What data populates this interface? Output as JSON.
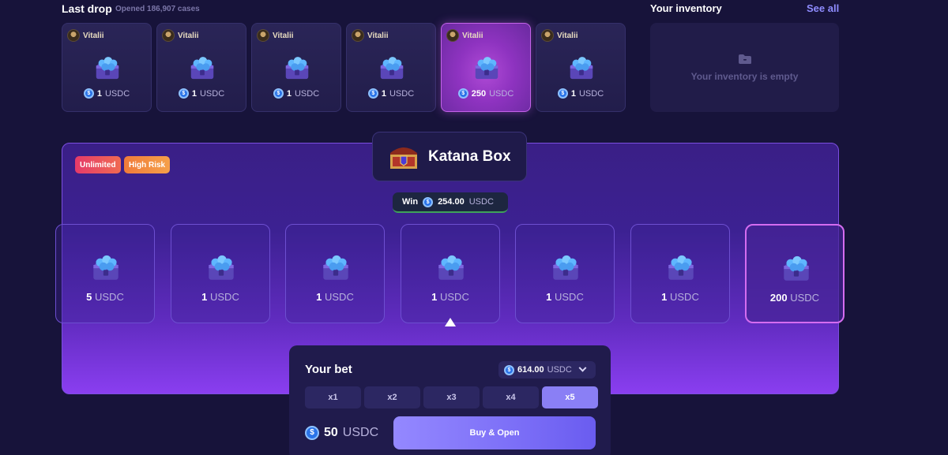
{
  "last_drop": {
    "title": "Last drop",
    "subtitle": "Opened 186,907 cases",
    "items": [
      {
        "user": "Vitalii",
        "amount": "1",
        "unit": "USDC",
        "highlight": false
      },
      {
        "user": "Vitalii",
        "amount": "1",
        "unit": "USDC",
        "highlight": false
      },
      {
        "user": "Vitalii",
        "amount": "1",
        "unit": "USDC",
        "highlight": false
      },
      {
        "user": "Vitalii",
        "amount": "1",
        "unit": "USDC",
        "highlight": false
      },
      {
        "user": "Vitalii",
        "amount": "250",
        "unit": "USDC",
        "highlight": true
      },
      {
        "user": "Vitalii",
        "amount": "1",
        "unit": "USDC",
        "highlight": false
      }
    ]
  },
  "inventory": {
    "title": "Your inventory",
    "see_all": "See all",
    "empty_text": "Your inventory is empty",
    "icon": "folder-icon"
  },
  "box": {
    "badges": [
      "Unlimited",
      "High Risk"
    ],
    "name": "Katana Box",
    "win_label": "Win",
    "win_amount": "254.00",
    "win_unit": "USDC"
  },
  "reel": [
    {
      "amount": "5",
      "unit": "USDC",
      "selected": false
    },
    {
      "amount": "1",
      "unit": "USDC",
      "selected": false
    },
    {
      "amount": "1",
      "unit": "USDC",
      "selected": false
    },
    {
      "amount": "1",
      "unit": "USDC",
      "selected": false
    },
    {
      "amount": "1",
      "unit": "USDC",
      "selected": false
    },
    {
      "amount": "1",
      "unit": "USDC",
      "selected": false
    },
    {
      "amount": "200",
      "unit": "USDC",
      "selected": true
    }
  ],
  "bet": {
    "title": "Your bet",
    "balance": "614.00",
    "balance_unit": "USDC",
    "multipliers": [
      "x1",
      "x2",
      "x3",
      "x4",
      "x5"
    ],
    "active_multiplier": "x5",
    "amount": "50",
    "amount_unit": "USDC",
    "buy_label": "Buy & Open"
  },
  "colors": {
    "background": "#17133a",
    "accent": "#8a7ff5",
    "highlight": "#d56cf0",
    "win_green": "#3fa15a"
  }
}
